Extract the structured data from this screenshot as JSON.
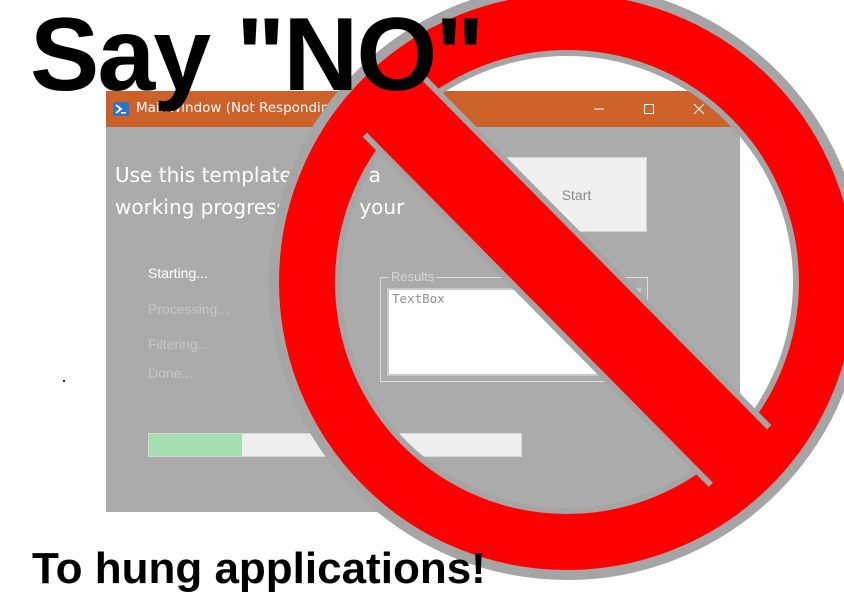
{
  "headline": "Say \"NO\"",
  "tagline": "To hung applications!",
  "window": {
    "title": "MainWindow (Not Responding)",
    "title_bar_color": "#cc6129",
    "body_color": "#ababab",
    "icon": "powershell-icon",
    "controls": [
      "minimize-icon",
      "maximize-icon",
      "close-icon"
    ],
    "intro_lines": [
      "Use this template to add a",
      "working progress bar to your"
    ],
    "start_button": "Start",
    "steps": [
      {
        "label": "Starting...",
        "active": true
      },
      {
        "label": "Processing...",
        "active": false
      },
      {
        "label": "Filtering...",
        "active": false
      },
      {
        "label": "Done...",
        "active": false
      }
    ],
    "results_group_label": "Results",
    "results_textbox": "TextBox",
    "progress_fraction": 0.25,
    "progress_fill_color": "#a6dfaf"
  },
  "overlay": {
    "symbol": "prohibition-sign",
    "color": "#ff0000",
    "outline_color": "#a5a5a5"
  }
}
